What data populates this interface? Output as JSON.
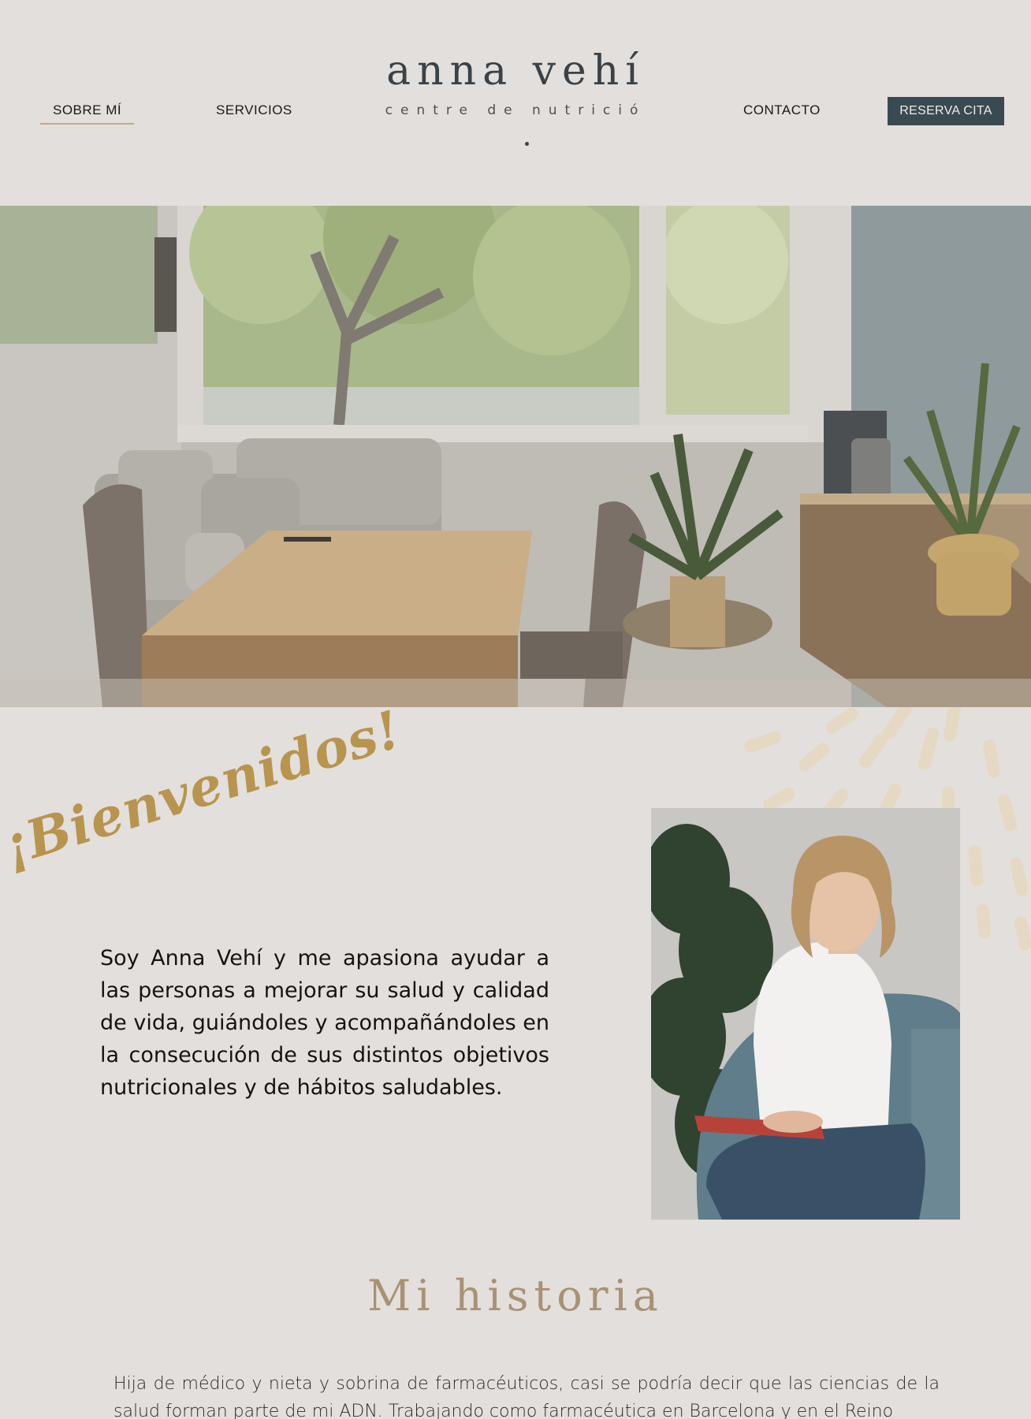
{
  "nav": {
    "items": [
      {
        "label": "SOBRE MÍ",
        "active": true
      },
      {
        "label": "SERVICIOS",
        "active": false
      },
      {
        "label": "CONTACTO",
        "active": false
      }
    ],
    "cta_label": "RESERVA CITA"
  },
  "logo": {
    "name": "anna vehí",
    "subtitle": "centre de nutrició"
  },
  "welcome": {
    "heading": "¡Bienvenidos!",
    "intro": "Soy Anna Vehí y me apasiona ayudar a las personas a mejorar su salud y calidad de vida, guiándoles y acompañándoles en la consecución de sus distintos objetivos nutricionales y de hábitos saludables."
  },
  "history": {
    "title": "Mi historia",
    "text": "Hija de médico y nieta y sobrina de farmacéuticos, casi se podría decir que las ciencias de la salud forman parte de mi ADN. Trabajando como farmacéutica en Barcelona y en el Reino"
  },
  "colors": {
    "background": "#e3dfdc",
    "accent_gold": "#c7ab74",
    "cta_background": "#3a4a52",
    "logo_text": "#3a4248",
    "script_gold": "#b8944e",
    "history_title": "#a89274"
  }
}
